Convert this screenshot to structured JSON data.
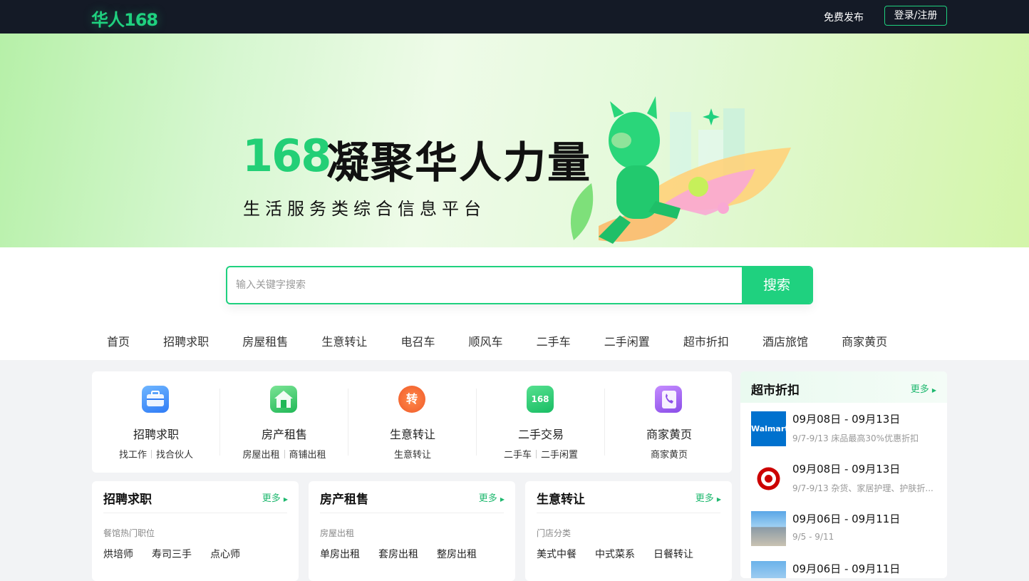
{
  "header": {
    "logo": "华人168",
    "publish": "免费发布",
    "login": "登录/注册"
  },
  "banner": {
    "number": "168",
    "title": "凝聚华人力量",
    "subtitle": "生活服务类综合信息平台"
  },
  "search": {
    "placeholder": "输入关键字搜索",
    "button": "搜索"
  },
  "nav": [
    "首页",
    "招聘求职",
    "房屋租售",
    "生意转让",
    "电召车",
    "顺风车",
    "二手车",
    "二手闲置",
    "超市折扣",
    "酒店旅馆",
    "商家黄页"
  ],
  "categories": [
    {
      "name": "招聘求职",
      "subs": [
        "找工作",
        "找合伙人"
      ],
      "icon": "briefcase-icon"
    },
    {
      "name": "房产租售",
      "subs": [
        "房屋出租",
        "商铺出租"
      ],
      "icon": "house-icon"
    },
    {
      "name": "生意转让",
      "subs": [
        "生意转让"
      ],
      "icon": "transfer-icon",
      "icon_text": "转"
    },
    {
      "name": "二手交易",
      "subs": [
        "二手车",
        "二手闲置"
      ],
      "icon": "secondhand-icon",
      "icon_text": "168"
    },
    {
      "name": "商家黄页",
      "subs": [
        "商家黄页"
      ],
      "icon": "phonebook-icon"
    }
  ],
  "panels": [
    {
      "title": "招聘求职",
      "more": "更多",
      "caption": "餐馆热门职位",
      "links": [
        "烘培师",
        "寿司三手",
        "点心师"
      ]
    },
    {
      "title": "房产租售",
      "more": "更多",
      "caption": "房屋出租",
      "links": [
        "单房出租",
        "套房出租",
        "整房出租"
      ]
    },
    {
      "title": "生意转让",
      "more": "更多",
      "caption": "门店分类",
      "links": [
        "美式中餐",
        "中式菜系",
        "日餐转让"
      ]
    }
  ],
  "deals": {
    "title": "超市折扣",
    "more": "更多",
    "items": [
      {
        "date": "09月08日 - 09月13日",
        "desc": "9/7-9/13 床品最高30%优惠折扣",
        "logo": "Walmart"
      },
      {
        "date": "09月08日 - 09月13日",
        "desc": "9/7-9/13 杂货、家居护理、护肤折...",
        "logo": "target-logo"
      },
      {
        "date": "09月06日 - 09月11日",
        "desc": "9/5 - 9/11",
        "logo": "store-photo"
      },
      {
        "date": "09月06日 - 09月11日",
        "desc": "",
        "logo": "store-photo"
      }
    ]
  },
  "colors": {
    "accent": "#1fd17f",
    "topbar": "#141a26"
  }
}
